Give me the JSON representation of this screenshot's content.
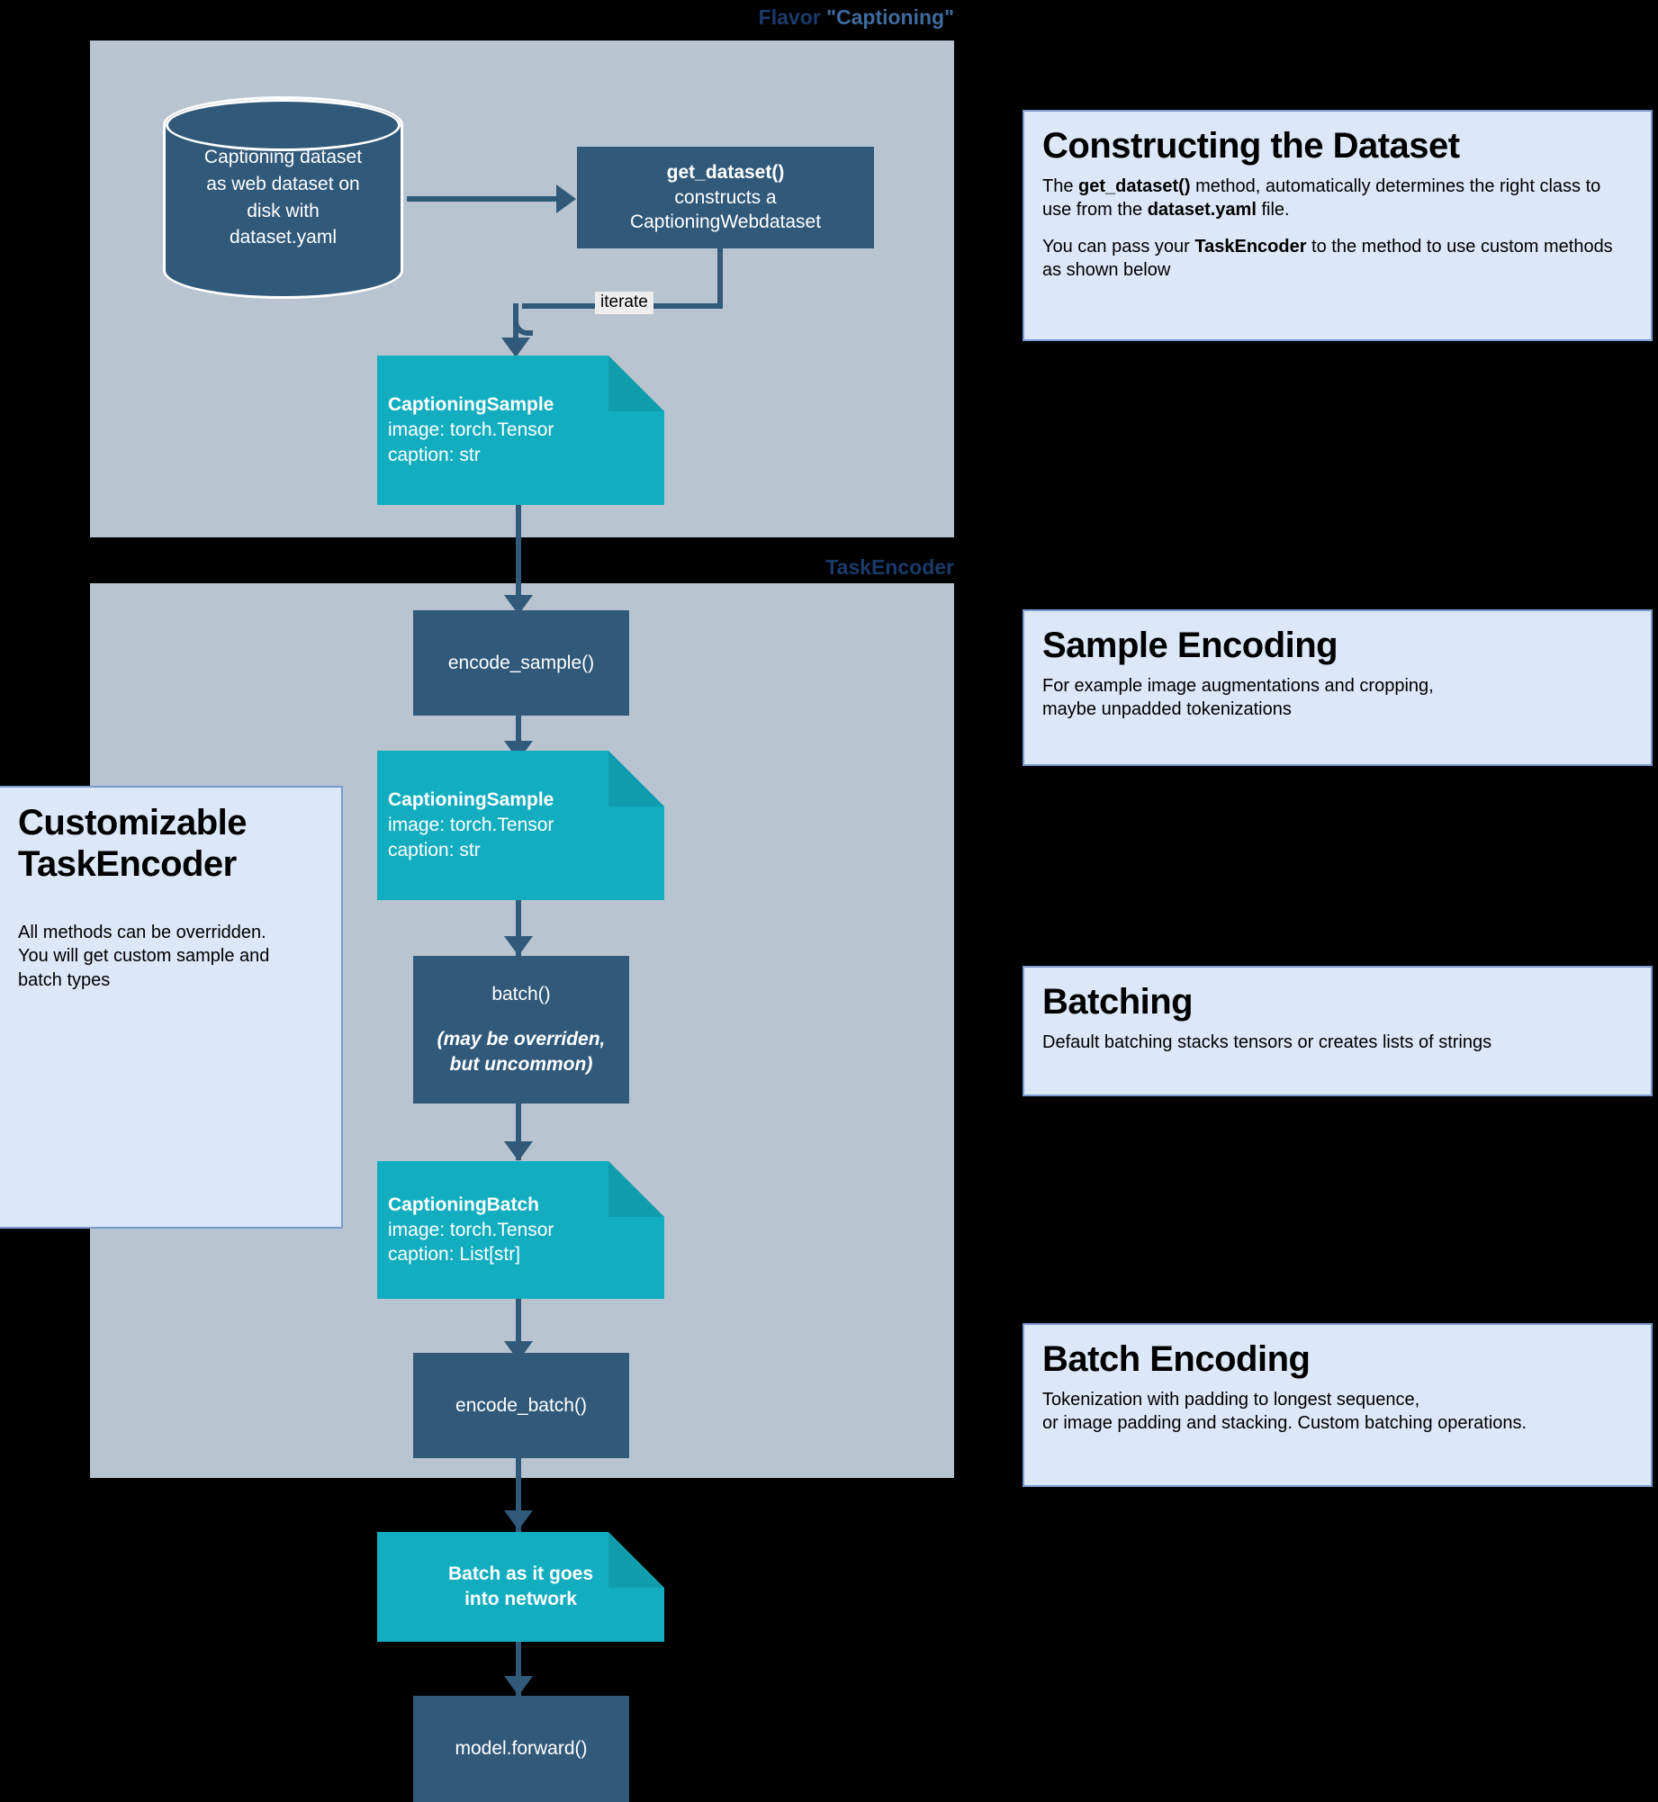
{
  "colors": {
    "background": "#000000",
    "group_panel": "#b8c5d0",
    "process_node": "#31597a",
    "data_node": "#12aec0",
    "data_node_fold": "#0f9dad",
    "callout_fill": "#dce7f8",
    "callout_border": "#7a9ad0",
    "label_dark": "#1b3a6b",
    "label_light": "#3f6b9e"
  },
  "groups": [
    {
      "id": "flavor",
      "label_prefix": "Flavor ",
      "label_quoted": "\"Captioning\""
    },
    {
      "id": "taskencoder",
      "label_prefix": "TaskEncoder",
      "label_quoted": ""
    }
  ],
  "nodes": {
    "dataset_cylinder": {
      "lines": [
        "Captioning dataset",
        "as web dataset on",
        "disk with",
        "dataset.yaml"
      ]
    },
    "get_dataset": {
      "line1": "get_dataset()",
      "line2": "constructs a",
      "line3": "CaptioningWebdataset"
    },
    "captioning_sample_1": {
      "title": "CaptioningSample",
      "field1": "image: torch.Tensor",
      "field2": "caption: str"
    },
    "encode_sample": {
      "label": "encode_sample()"
    },
    "captioning_sample_2": {
      "title": "CaptioningSample",
      "field1": "image: torch.Tensor",
      "field2": "caption: str"
    },
    "batch": {
      "label": "batch()",
      "note_line1": "(may be overriden,",
      "note_line2": "but uncommon)"
    },
    "captioning_batch": {
      "title": "CaptioningBatch",
      "field1": "image: torch.Tensor",
      "field2": "caption: List[str]"
    },
    "encode_batch": {
      "label": "encode_batch()"
    },
    "final_batch": {
      "line1": "Batch as it goes",
      "line2": "into network"
    },
    "model_forward": {
      "label": "model.forward()"
    }
  },
  "edges": {
    "iterate_label": "iterate"
  },
  "callouts": {
    "constructing_dataset": {
      "title": "Constructing the Dataset",
      "para1_pre": "The ",
      "para1_b1": "get_dataset()",
      "para1_mid": " method, automatically determines the right class to use from the ",
      "para1_b2": "dataset.yaml",
      "para1_post": " file.",
      "para2_pre": "You can pass your ",
      "para2_b1": "TaskEncoder",
      "para2_post": " to the method to use custom methods as shown below"
    },
    "sample_encoding": {
      "title": "Sample Encoding",
      "body_line1": "For example image augmentations and cropping,",
      "body_line2": "maybe unpadded tokenizations"
    },
    "batching": {
      "title": "Batching",
      "body_line1": "Default batching stacks tensors or creates lists of strings"
    },
    "batch_encoding": {
      "title": "Batch Encoding",
      "body_line1": "Tokenization with padding to longest sequence,",
      "body_line2": "or image padding and stacking. Custom batching operations."
    },
    "customizable_taskencoder": {
      "title_line1": "Customizable",
      "title_line2": "TaskEncoder",
      "body_line1": "All methods can be overridden.",
      "body_line2": "You will get custom sample and",
      "body_line3": "batch types"
    }
  }
}
